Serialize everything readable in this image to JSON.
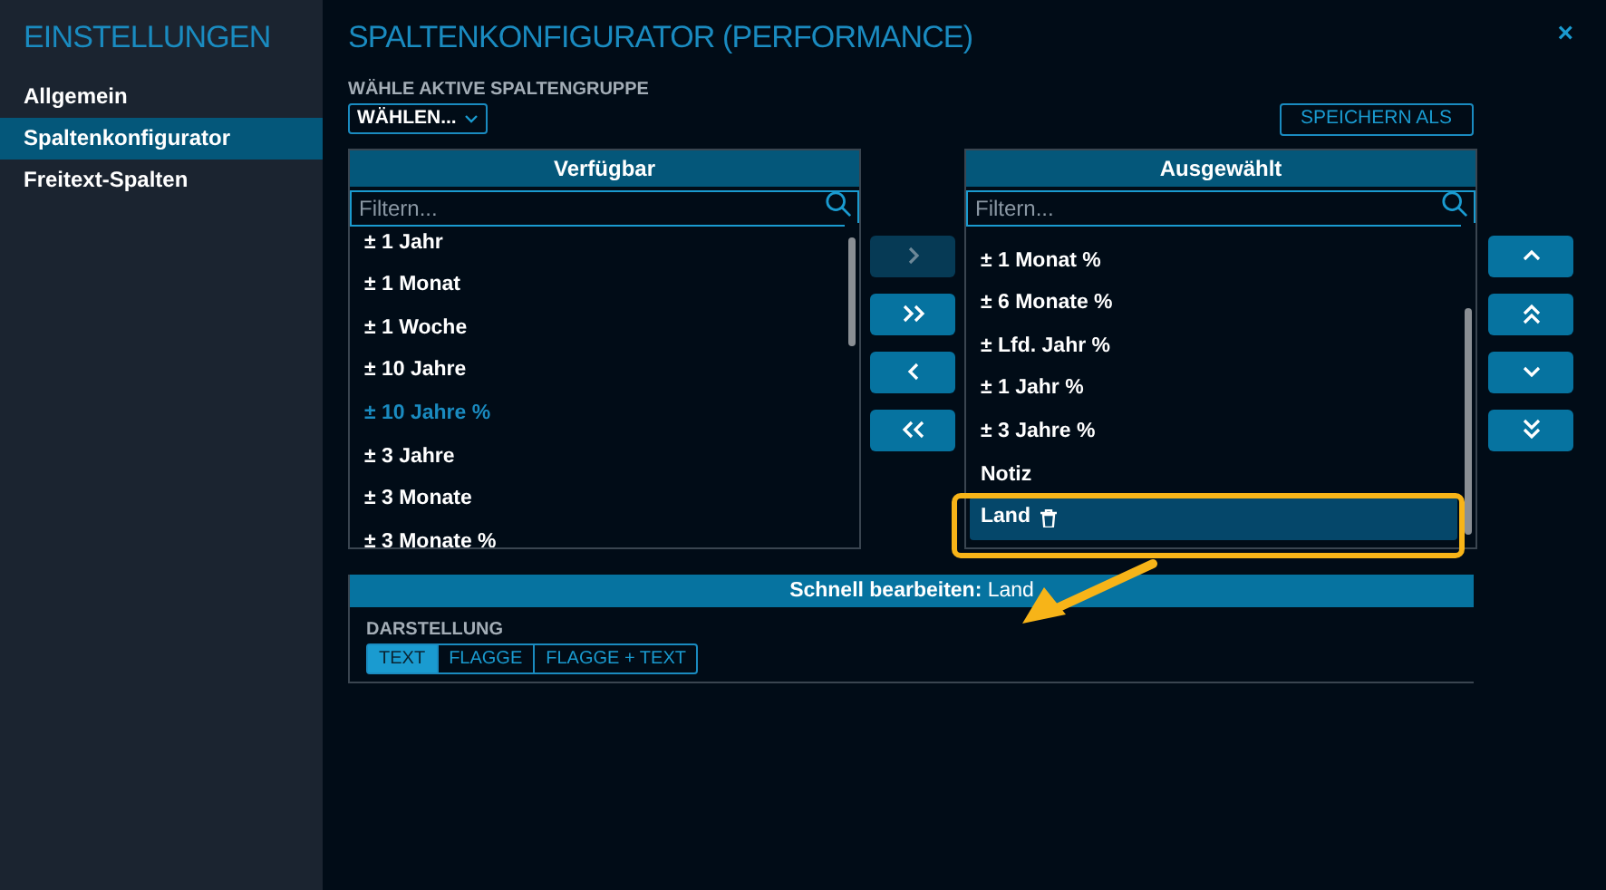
{
  "sidebar": {
    "title": "EINSTELLUNGEN",
    "items": [
      {
        "label": "Allgemein",
        "selected": false
      },
      {
        "label": "Spaltenkonfigurator",
        "selected": true
      },
      {
        "label": "Freitext-Spalten",
        "selected": false
      }
    ]
  },
  "main": {
    "title": "SPALTENKONFIGURATOR (PERFORMANCE)",
    "close": "×",
    "group_label": "WÄHLE AKTIVE SPALTENGRUPPE",
    "group_select": "WÄHLEN...",
    "save_as": "SPEICHERN ALS"
  },
  "available": {
    "title": "Verfügbar",
    "placeholder": "Filtern...",
    "items": [
      {
        "label": "± 1 Jahr",
        "selected": false
      },
      {
        "label": "± 1 Monat",
        "selected": false
      },
      {
        "label": "± 1 Woche",
        "selected": false
      },
      {
        "label": "± 10 Jahre",
        "selected": false
      },
      {
        "label": "± 10 Jahre %",
        "selected": true
      },
      {
        "label": "± 3 Jahre",
        "selected": false
      },
      {
        "label": "± 3 Monate",
        "selected": false
      },
      {
        "label": "± 3 Monate %",
        "selected": false
      }
    ]
  },
  "move_buttons": [
    {
      "kind": "right",
      "disabled": true
    },
    {
      "kind": "all-right",
      "disabled": false
    },
    {
      "kind": "left",
      "disabled": false
    },
    {
      "kind": "all-left",
      "disabled": false
    }
  ],
  "selected": {
    "title": "Ausgewählt",
    "placeholder": "Filtern...",
    "items": [
      {
        "label": "± 1 Monat %",
        "selected": false
      },
      {
        "label": "± 6 Monate %",
        "selected": false
      },
      {
        "label": "± Lfd. Jahr %",
        "selected": false
      },
      {
        "label": "± 1 Jahr %",
        "selected": false
      },
      {
        "label": "± 3 Jahre %",
        "selected": false
      },
      {
        "label": "Notiz",
        "selected": false
      },
      {
        "label": "Land",
        "selected": true
      }
    ]
  },
  "order_buttons": [
    {
      "kind": "up"
    },
    {
      "kind": "top"
    },
    {
      "kind": "down"
    },
    {
      "kind": "bottom"
    }
  ],
  "quick_edit": {
    "title": "**Schnell bearbeiten:** Land",
    "section": "DARSTELLUNG",
    "options": [
      {
        "label": "TEXT",
        "selected": true
      },
      {
        "label": "FLAGGE",
        "selected": false
      },
      {
        "label": "FLAGGE + TEXT",
        "selected": false
      }
    ]
  }
}
